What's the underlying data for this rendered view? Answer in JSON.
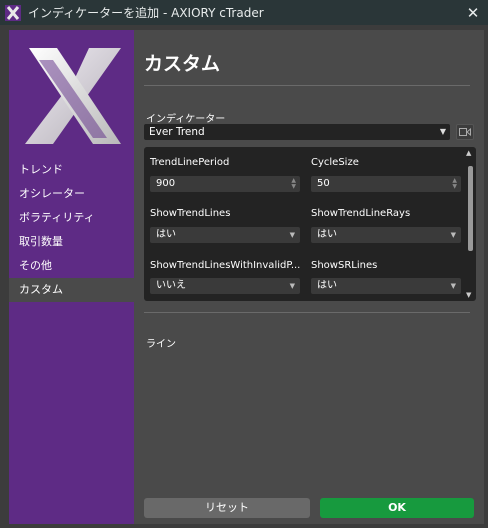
{
  "window": {
    "title": "インディケーターを追加 - AXIORY cTrader"
  },
  "sidebar": {
    "items": [
      {
        "label": "トレンド"
      },
      {
        "label": "オシレーター"
      },
      {
        "label": "ボラティリティ"
      },
      {
        "label": "取引数量"
      },
      {
        "label": "その他"
      },
      {
        "label": "カスタム",
        "active": true
      }
    ]
  },
  "main": {
    "heading": "カスタム",
    "indicator_label": "インディケーター",
    "indicator_value": "Ever Trend",
    "params": [
      {
        "label": "TrendLinePeriod",
        "value": "900"
      },
      {
        "label": "CycleSize",
        "value": "50"
      },
      {
        "label": "ShowTrendLines",
        "value": "はい"
      },
      {
        "label": "ShowTrendLineRays",
        "value": "はい"
      },
      {
        "label": "ShowTrendLinesWithInvalidP...",
        "value": "いいえ"
      },
      {
        "label": "ShowSRLines",
        "value": "はい"
      }
    ],
    "line_label": "ライン"
  },
  "buttons": {
    "reset": "リセット",
    "ok": "OK"
  },
  "colors": {
    "sidebar": "#5e2b85",
    "ok": "#179a3e",
    "titlebar": "#2a3638"
  }
}
